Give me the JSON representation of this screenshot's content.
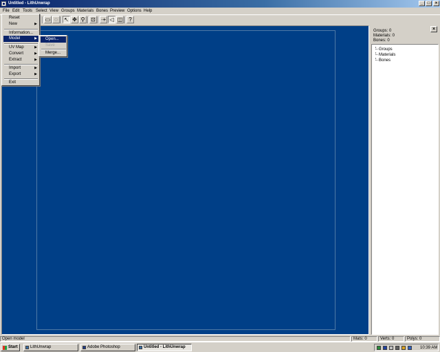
{
  "window": {
    "title": "Untitled - LithUnwrap",
    "controls": [
      "_",
      "□",
      "×"
    ]
  },
  "menubar": [
    "File",
    "Edit",
    "Tools",
    "Select",
    "View",
    "Groups",
    "Materials",
    "Bones",
    "Preview",
    "Options",
    "Help"
  ],
  "file_menu": {
    "items": [
      "Reset",
      "New",
      "Information...",
      "Model",
      "UV Map",
      "Convert",
      "Extract",
      "Import",
      "Export",
      "Exit"
    ],
    "highlighted": "Model"
  },
  "model_submenu": {
    "items": [
      "Open...",
      "Save",
      "Merge..."
    ],
    "highlighted": "Open...",
    "disabled": "Save"
  },
  "toolbar_icons": [
    "select-box-icon",
    "select-lasso-icon",
    "pointer-icon",
    "move-icon",
    "zoom-icon",
    "zoom-fit-icon",
    "vertex-icon",
    "polygon-icon",
    "face-icon",
    "help-pointer-icon"
  ],
  "right_panel": {
    "stats": [
      "Groups: 0",
      "Materials: 0",
      "Bones: 0"
    ],
    "tree": [
      "Groups",
      "Materials",
      "Bones"
    ],
    "close": "×"
  },
  "statusbar": {
    "message": "Open model",
    "mats": "Mats: 0",
    "verts": "Verts: 0",
    "polys": "Polys: 0"
  },
  "taskbar": {
    "start": "Start",
    "tasks": [
      "LithUnwrap",
      "Adobe Photoshop",
      "Untitled - LithUnwrap"
    ],
    "active_task": "Untitled - LithUnwrap",
    "clock": "10:39 AM"
  },
  "colors": {
    "viewport": "#003f87",
    "titlebar": "#0a246a",
    "chrome": "#d4d0c8"
  }
}
